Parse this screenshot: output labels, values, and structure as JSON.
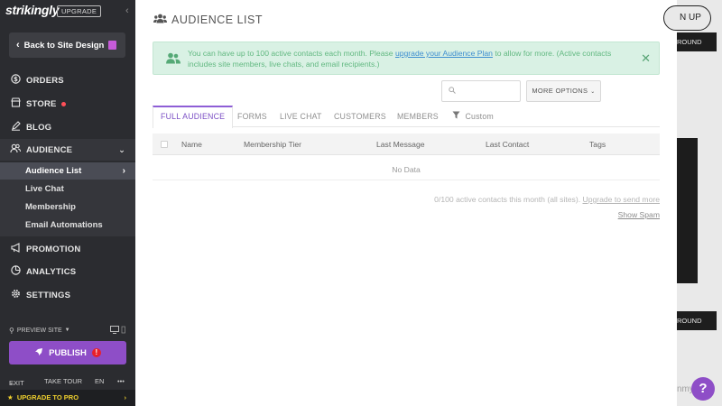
{
  "sidebar": {
    "logo": "strikingly",
    "upgrade_badge": "UPGRADE",
    "back_label": "Back to Site Design",
    "nav": {
      "orders": "ORDERS",
      "store": "STORE",
      "blog": "BLOG",
      "audience": "AUDIENCE",
      "promotion": "PROMOTION",
      "analytics": "ANALYTICS",
      "settings": "SETTINGS"
    },
    "audience_sub": [
      "Audience List",
      "Live Chat",
      "Membership",
      "Email Automations"
    ],
    "preview_label": "PREVIEW SITE",
    "publish_label": "PUBLISH",
    "publish_alert": "!",
    "footer": {
      "exit": "EXIT",
      "tour": "TAKE TOUR",
      "lang": "EN",
      "more": "•••"
    },
    "upgrade_pro": "UPGRADE TO PRO"
  },
  "main": {
    "title": "AUDIENCE LIST",
    "banner": {
      "text_before": "You can have up to 100 active contacts each month. Please ",
      "link": "upgrade your Audience Plan",
      "text_after": " to allow for more. (Active contacts includes site members, live chats, and email recipients.)"
    },
    "more_options": "MORE OPTIONS",
    "tabs": [
      "FULL AUDIENCE",
      "FORMS",
      "LIVE CHAT",
      "CUSTOMERS",
      "MEMBERS",
      "Custom"
    ],
    "table": {
      "columns": [
        "Name",
        "Membership Tier",
        "Last Message",
        "Last Contact",
        "Tags"
      ],
      "empty": "No Data"
    },
    "contacts_text": "0/100 active contacts this month (all sites).",
    "contacts_link": "Upgrade to send more",
    "show_spam": "Show Spam"
  },
  "background": {
    "sign_up": "N UP",
    "btn1": "ROUND",
    "btn2": "ROUND",
    "partial_text": "nmy"
  },
  "colors": {
    "sidebar_bg": "#2b2c30",
    "accent_purple": "#8e4ec7",
    "banner_bg": "#d9f1e4",
    "banner_text": "#63b982",
    "link_blue": "#3d8ed0",
    "store_dot": "#ff4f58"
  },
  "icons": {
    "orders": "dollar-circle-icon",
    "store": "storefront-icon",
    "blog": "pen-icon",
    "audience": "users-icon",
    "promotion": "megaphone-icon",
    "analytics": "pie-chart-icon",
    "settings": "gear-icon"
  }
}
